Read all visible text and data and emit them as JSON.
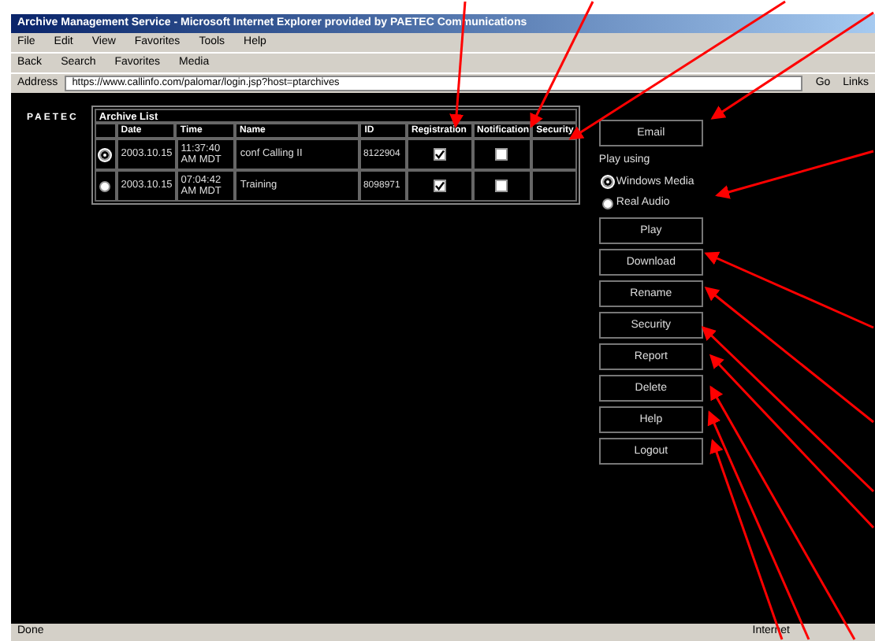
{
  "window": {
    "title": "Archive Management Service - Microsoft Internet Explorer provided by PAETEC Communications"
  },
  "menu": [
    "File",
    "Edit",
    "View",
    "Favorites",
    "Tools",
    "Help"
  ],
  "toolbar": [
    "Back",
    "Search",
    "Favorites",
    "Media"
  ],
  "address": {
    "label": "Address",
    "value": "https://www.callinfo.com/palomar/login.jsp?host=ptarchives",
    "go": "Go",
    "links": "Links"
  },
  "logo": "PAETEC",
  "table": {
    "caption": "Archive List",
    "columns": [
      "Date",
      "Time",
      "Name",
      "ID",
      "Registration",
      "Notification",
      "Security"
    ],
    "rows": [
      {
        "selected": true,
        "date": "2003.10.15",
        "time": "11:37:40 AM MDT",
        "name": "conf Calling II",
        "id": "8122904",
        "registration": true,
        "notification": false
      },
      {
        "selected": false,
        "date": "2003.10.15",
        "time": "07:04:42 AM MDT",
        "name": "Training",
        "id": "8098971",
        "registration": true,
        "notification": false
      }
    ]
  },
  "email_button": "Email",
  "play_using": {
    "label": "Play using",
    "options": [
      {
        "label": "Windows Media",
        "selected": true
      },
      {
        "label": "Real Audio",
        "selected": false
      }
    ]
  },
  "buttons": [
    "Play",
    "Download",
    "Rename",
    "Security",
    "Report",
    "Delete",
    "Help",
    "Logout"
  ],
  "status_bar": {
    "text": "Done",
    "zone": "Internet"
  }
}
